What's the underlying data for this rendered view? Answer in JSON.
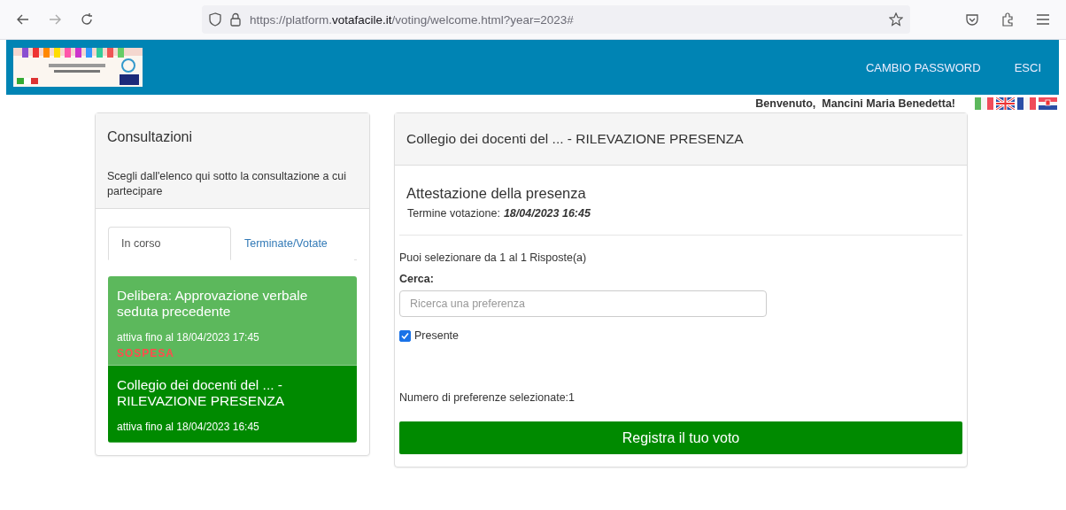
{
  "browser": {
    "url": "https://platform.**votafacile.it**/voting/welcome.html?year=2023#"
  },
  "header": {
    "links": [
      "CAMBIO PASSWORD",
      "ESCI"
    ]
  },
  "welcome": "Benvenuto,  Mancini Maria Benedetta!",
  "languages": [
    {
      "kind": "it"
    },
    {
      "kind": "uk"
    },
    {
      "kind": "fr"
    },
    {
      "kind": "hr"
    }
  ],
  "sidebar": {
    "title": "Consultazioni",
    "description": "Scegli dall'elenco qui sotto la consultazione a cui partecipare",
    "tabs": [
      {
        "label": "In corso",
        "selected": true
      },
      {
        "label": "Terminate/Votate",
        "selected": false
      }
    ],
    "items": [
      {
        "title": "Delibera: Approvazione verbale seduta precedente",
        "deadline": "attiva fino al 18/04/2023 17:45",
        "status": "SOSPESA",
        "selected": false
      },
      {
        "title": "Collegio dei docenti del ... - RILEVAZIONE PRESENZA",
        "deadline": "attiva fino al 18/04/2023 16:45",
        "selected": true
      }
    ]
  },
  "main": {
    "title": "Collegio dei docenti del ... - RILEVAZIONE PRESENZA",
    "subtitle": "Attestazione della presenza",
    "deadline_label": "Termine votazione:",
    "deadline": "18/04/2023 16:45",
    "instructions": "Puoi selezionare da 1 al 1 Risposte(a)",
    "search_label": "Cerca:",
    "search": {
      "placeholder": "Ricerca una preferenza"
    },
    "options": [
      {
        "label": "Presente",
        "checked": true
      }
    ],
    "count": "Numero di preferenze selezionate:1",
    "submit": "Registra il tuo voto"
  }
}
